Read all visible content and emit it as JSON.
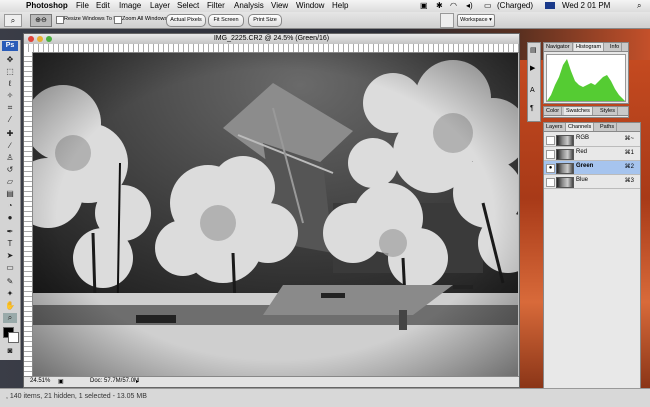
{
  "menubar": {
    "app": "Photoshop",
    "items": [
      "File",
      "Edit",
      "Image",
      "Layer",
      "Select",
      "Filter",
      "Analysis",
      "View",
      "Window",
      "Help"
    ],
    "battery": "(Charged)",
    "clock": "Wed 2 01 PM"
  },
  "options": {
    "resize": "Resize Windows To Fit",
    "zoom_all": "Zoom All Windows",
    "actual": "Actual Pixels",
    "fit": "Fit Screen",
    "print": "Print Size",
    "workspace": "Workspace"
  },
  "document": {
    "title": "IMG_2225.CR2 @ 24.5% (Green/16)",
    "zoom": "24.51%",
    "doc_size": "Doc: 57.7M/57.0M"
  },
  "panels": {
    "top_tabs": [
      "Navigator",
      "Histogram",
      "Info"
    ],
    "mid_tabs": [
      "Color",
      "Swatches",
      "Styles"
    ],
    "ch_tabs": [
      "Layers",
      "Channels",
      "Paths"
    ],
    "channels": [
      {
        "name": "RGB",
        "key": "⌘~"
      },
      {
        "name": "Red",
        "key": "⌘1"
      },
      {
        "name": "Green",
        "key": "⌘2"
      },
      {
        "name": "Blue",
        "key": "⌘3"
      }
    ]
  },
  "finder": {
    "status": ", 140 items, 21 hidden, 1 selected - 13.05 MB"
  },
  "colors": {
    "selected_row": "#a6c4ee",
    "histogram": "#55cc33"
  }
}
